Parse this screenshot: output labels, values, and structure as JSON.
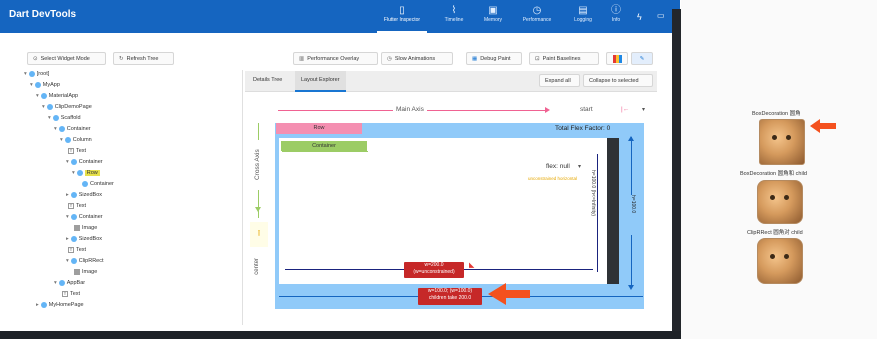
{
  "app": {
    "title": "Dart DevTools"
  },
  "nav": {
    "tabs": [
      {
        "label": "Flutter Inspector",
        "icon": "phone-icon",
        "glyph": "▯",
        "active": true
      },
      {
        "label": "Timeline",
        "icon": "timeline-icon",
        "glyph": "⌇"
      },
      {
        "label": "Memory",
        "icon": "memory-icon",
        "glyph": "▣"
      },
      {
        "label": "Performance",
        "icon": "performance-icon",
        "glyph": "◷"
      },
      {
        "label": "Logging",
        "icon": "logging-icon",
        "glyph": "▤"
      },
      {
        "label": "Info",
        "icon": "info-icon",
        "glyph": "ⓘ"
      }
    ],
    "extra_icons": [
      "bolt-icon",
      "chat-icon"
    ]
  },
  "toolbar": {
    "select_widget_mode": "Select Widget Mode",
    "refresh_tree": "Refresh Tree",
    "performance_overlay": "Performance Overlay",
    "slow_animations": "Slow Animations",
    "debug_paint": "Debug Paint",
    "paint_baselines": "Paint Baselines"
  },
  "tree": [
    {
      "label": "[root]",
      "kind": "dot",
      "expander": "▾"
    },
    {
      "label": "MyApp",
      "kind": "dot",
      "expander": "▾"
    },
    {
      "label": "MaterialApp",
      "kind": "dot",
      "expander": "▾"
    },
    {
      "label": "ClipDemoPage",
      "kind": "dot",
      "expander": "▾"
    },
    {
      "label": "Scaffold",
      "kind": "dot",
      "expander": "▾"
    },
    {
      "label": "Container",
      "kind": "dot",
      "expander": "▾"
    },
    {
      "label": "Column",
      "kind": "dot",
      "expander": "▾"
    },
    {
      "label": "Text",
      "kind": "box",
      "expander": ""
    },
    {
      "label": "Container",
      "kind": "dot",
      "expander": "▾"
    },
    {
      "label": "Row",
      "kind": "dot",
      "expander": "▾",
      "selected": true
    },
    {
      "label": "Container",
      "kind": "dot",
      "expander": ""
    },
    {
      "label": "SizedBox",
      "kind": "dot",
      "expander": "▸"
    },
    {
      "label": "Text",
      "kind": "box",
      "expander": ""
    },
    {
      "label": "Container",
      "kind": "dot",
      "expander": "▾"
    },
    {
      "label": "Image",
      "kind": "img",
      "expander": ""
    },
    {
      "label": "SizedBox",
      "kind": "dot",
      "expander": "▸"
    },
    {
      "label": "Text",
      "kind": "box",
      "expander": ""
    },
    {
      "label": "ClipRRect",
      "kind": "dot",
      "expander": "▾"
    },
    {
      "label": "Image",
      "kind": "img",
      "expander": ""
    },
    {
      "label": "AppBar",
      "kind": "dot",
      "expander": "▾"
    },
    {
      "label": "Text",
      "kind": "box",
      "expander": ""
    },
    {
      "label": "MyHomePage",
      "kind": "dot",
      "expander": "▸"
    }
  ],
  "explorer": {
    "tabs": [
      "Details Tree",
      "Layout Explorer"
    ],
    "expand_all": "Expand all",
    "collapse_to_selected": "Collapse to selected",
    "main_axis": "Main Axis",
    "cross_axis": "Cross Axis",
    "main_alignment": "start",
    "cross_alignment": "start",
    "row_label": "Row",
    "total_flex": "Total Flex Factor: 0",
    "container_label": "Container",
    "flex_value": "flex: null",
    "flex_sub": "unconstrained horizontal",
    "height_inner": "h=100.0 (h<=Infinity)",
    "height_outer": "h=100.0",
    "child_size_line1": "w=200.0",
    "child_size_line2": "(w=unconstrained)",
    "parent_size_line1": "w=100.0; (w=100.0)",
    "parent_size_line2": "children take 200.0",
    "left_vertical": "center"
  },
  "device": {
    "label1": "BoxDecoration 圆角",
    "label2": "BoxDecoration 圆角和 child",
    "label3": "ClipRRect 圆角对 child"
  }
}
